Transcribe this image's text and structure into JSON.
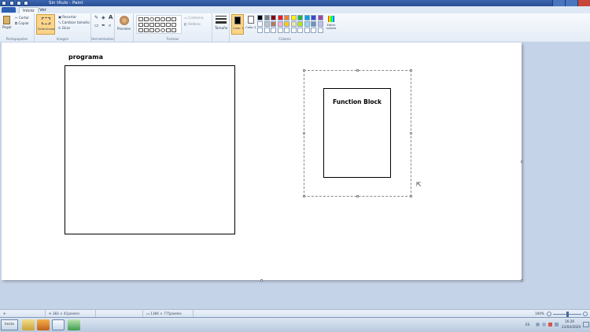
{
  "window": {
    "title": "Sin título - Paint"
  },
  "menu": {
    "tabs": [
      {
        "label": "Inicio"
      },
      {
        "label": "Ver"
      }
    ]
  },
  "ribbon": {
    "clipboard": {
      "paste": "Pegar",
      "cut": "Cortar",
      "copy": "Copiar",
      "group": "Portapapeles"
    },
    "image": {
      "select": "Seleccionar",
      "crop": "Recortar",
      "resize": "Cambiar tamaño",
      "rotate": "Girar",
      "group": "Imagen"
    },
    "tools": {
      "group": "Herramientas"
    },
    "brushes": {
      "label": "Pinceles"
    },
    "shapes": {
      "outline": "Contorno",
      "fill": "Relleno",
      "group": "Formas"
    },
    "size": {
      "label": "Tamaño"
    },
    "colors": {
      "color1": "Color 1",
      "color2": "Color 2",
      "edit": "Editar colores",
      "group": "Colores",
      "palette_row1": [
        "#000000",
        "#7f7f7f",
        "#880015",
        "#ed1c24",
        "#ff7f27",
        "#fff200",
        "#22b14c",
        "#00a2e8",
        "#3f48cc",
        "#a349a4"
      ],
      "palette_row2": [
        "#ffffff",
        "#c3c3c3",
        "#b97a57",
        "#ffaec9",
        "#ffc90e",
        "#efe4b0",
        "#b5e61d",
        "#99d9ea",
        "#7092be",
        "#c8bfe7"
      ],
      "primary": "#000000",
      "secondary": "#ffffff"
    }
  },
  "canvas": {
    "label_programa": "programa",
    "label_function_block": "Function Block"
  },
  "status": {
    "cursor_pos": "383 × 41píxeles",
    "canvas_size": "1366 × 775píxeles",
    "zoom": "100%"
  },
  "taskbar": {
    "start": "Inicio",
    "lang": "ES",
    "time": "16:26",
    "date": "23/04/2020"
  }
}
